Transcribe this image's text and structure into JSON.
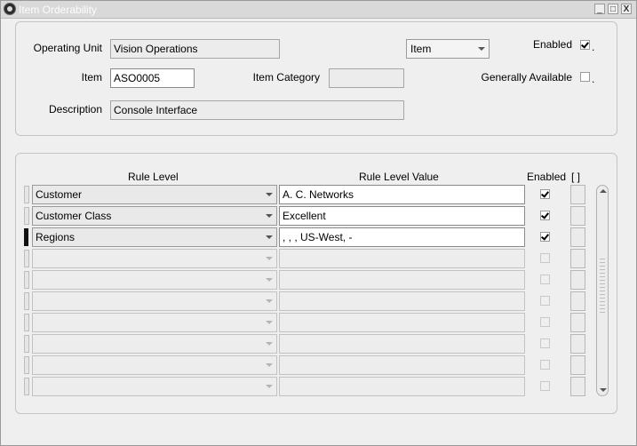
{
  "window": {
    "title": "Item Orderability",
    "minimize": "_",
    "maximize": "□",
    "close": "X"
  },
  "header": {
    "operating_unit_label": "Operating Unit",
    "operating_unit_value": "Vision Operations",
    "type_select_value": "Item",
    "enabled_label": "Enabled",
    "enabled_checked": true,
    "item_label": "Item",
    "item_value": "ASO0005",
    "item_category_label": "Item Category",
    "item_category_value": "",
    "generally_available_label": "Generally Available",
    "generally_available_checked": false,
    "description_label": "Description",
    "description_value": "Console Interface"
  },
  "rules": {
    "col_rule_level": "Rule Level",
    "col_rule_level_value": "Rule Level Value",
    "col_enabled": "Enabled",
    "col_extra": "[ ]",
    "rows": [
      {
        "rule_level": "Customer",
        "value": "A. C. Networks",
        "enabled": true,
        "current": false
      },
      {
        "rule_level": "Customer Class",
        "value": "Excellent",
        "enabled": true,
        "current": false
      },
      {
        "rule_level": "Regions",
        "value": ", , , US-West,  -",
        "enabled": true,
        "current": true
      },
      {
        "rule_level": "",
        "value": "",
        "enabled": false,
        "current": false
      },
      {
        "rule_level": "",
        "value": "",
        "enabled": false,
        "current": false
      },
      {
        "rule_level": "",
        "value": "",
        "enabled": false,
        "current": false
      },
      {
        "rule_level": "",
        "value": "",
        "enabled": false,
        "current": false
      },
      {
        "rule_level": "",
        "value": "",
        "enabled": false,
        "current": false
      },
      {
        "rule_level": "",
        "value": "",
        "enabled": false,
        "current": false
      },
      {
        "rule_level": "",
        "value": "",
        "enabled": false,
        "current": false
      }
    ]
  }
}
